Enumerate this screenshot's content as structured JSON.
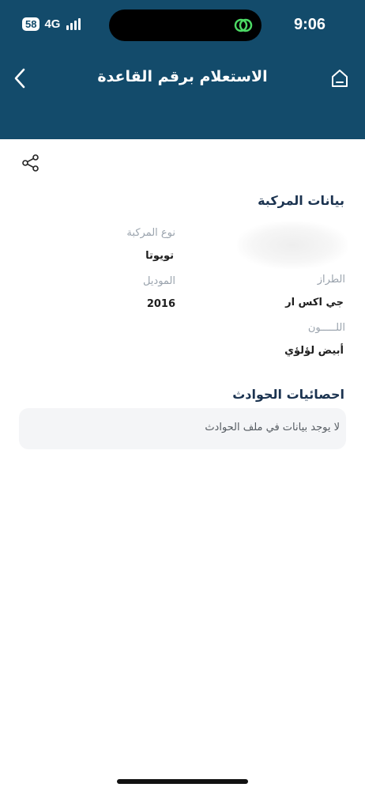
{
  "status_bar": {
    "time": "9:06",
    "battery": "58",
    "network": "4G"
  },
  "header": {
    "title": "الاستعلام برقم القاعدة",
    "background_color": "#134b6b"
  },
  "vehicle": {
    "section_title": "بيانات المركبة",
    "type_label": "نوع المركبة",
    "type_value": "تويوتا",
    "model_label": "الموديل",
    "model_value": "2016",
    "trim_label": "الطراز",
    "trim_value": "جي اكس ار",
    "color_label": "اللـــــون",
    "color_value": "أبيض لؤلؤي"
  },
  "accidents": {
    "section_title": "احصائيات الحوادث",
    "empty_message": "لا يوجد بيانات  في ملف الحوادث"
  }
}
